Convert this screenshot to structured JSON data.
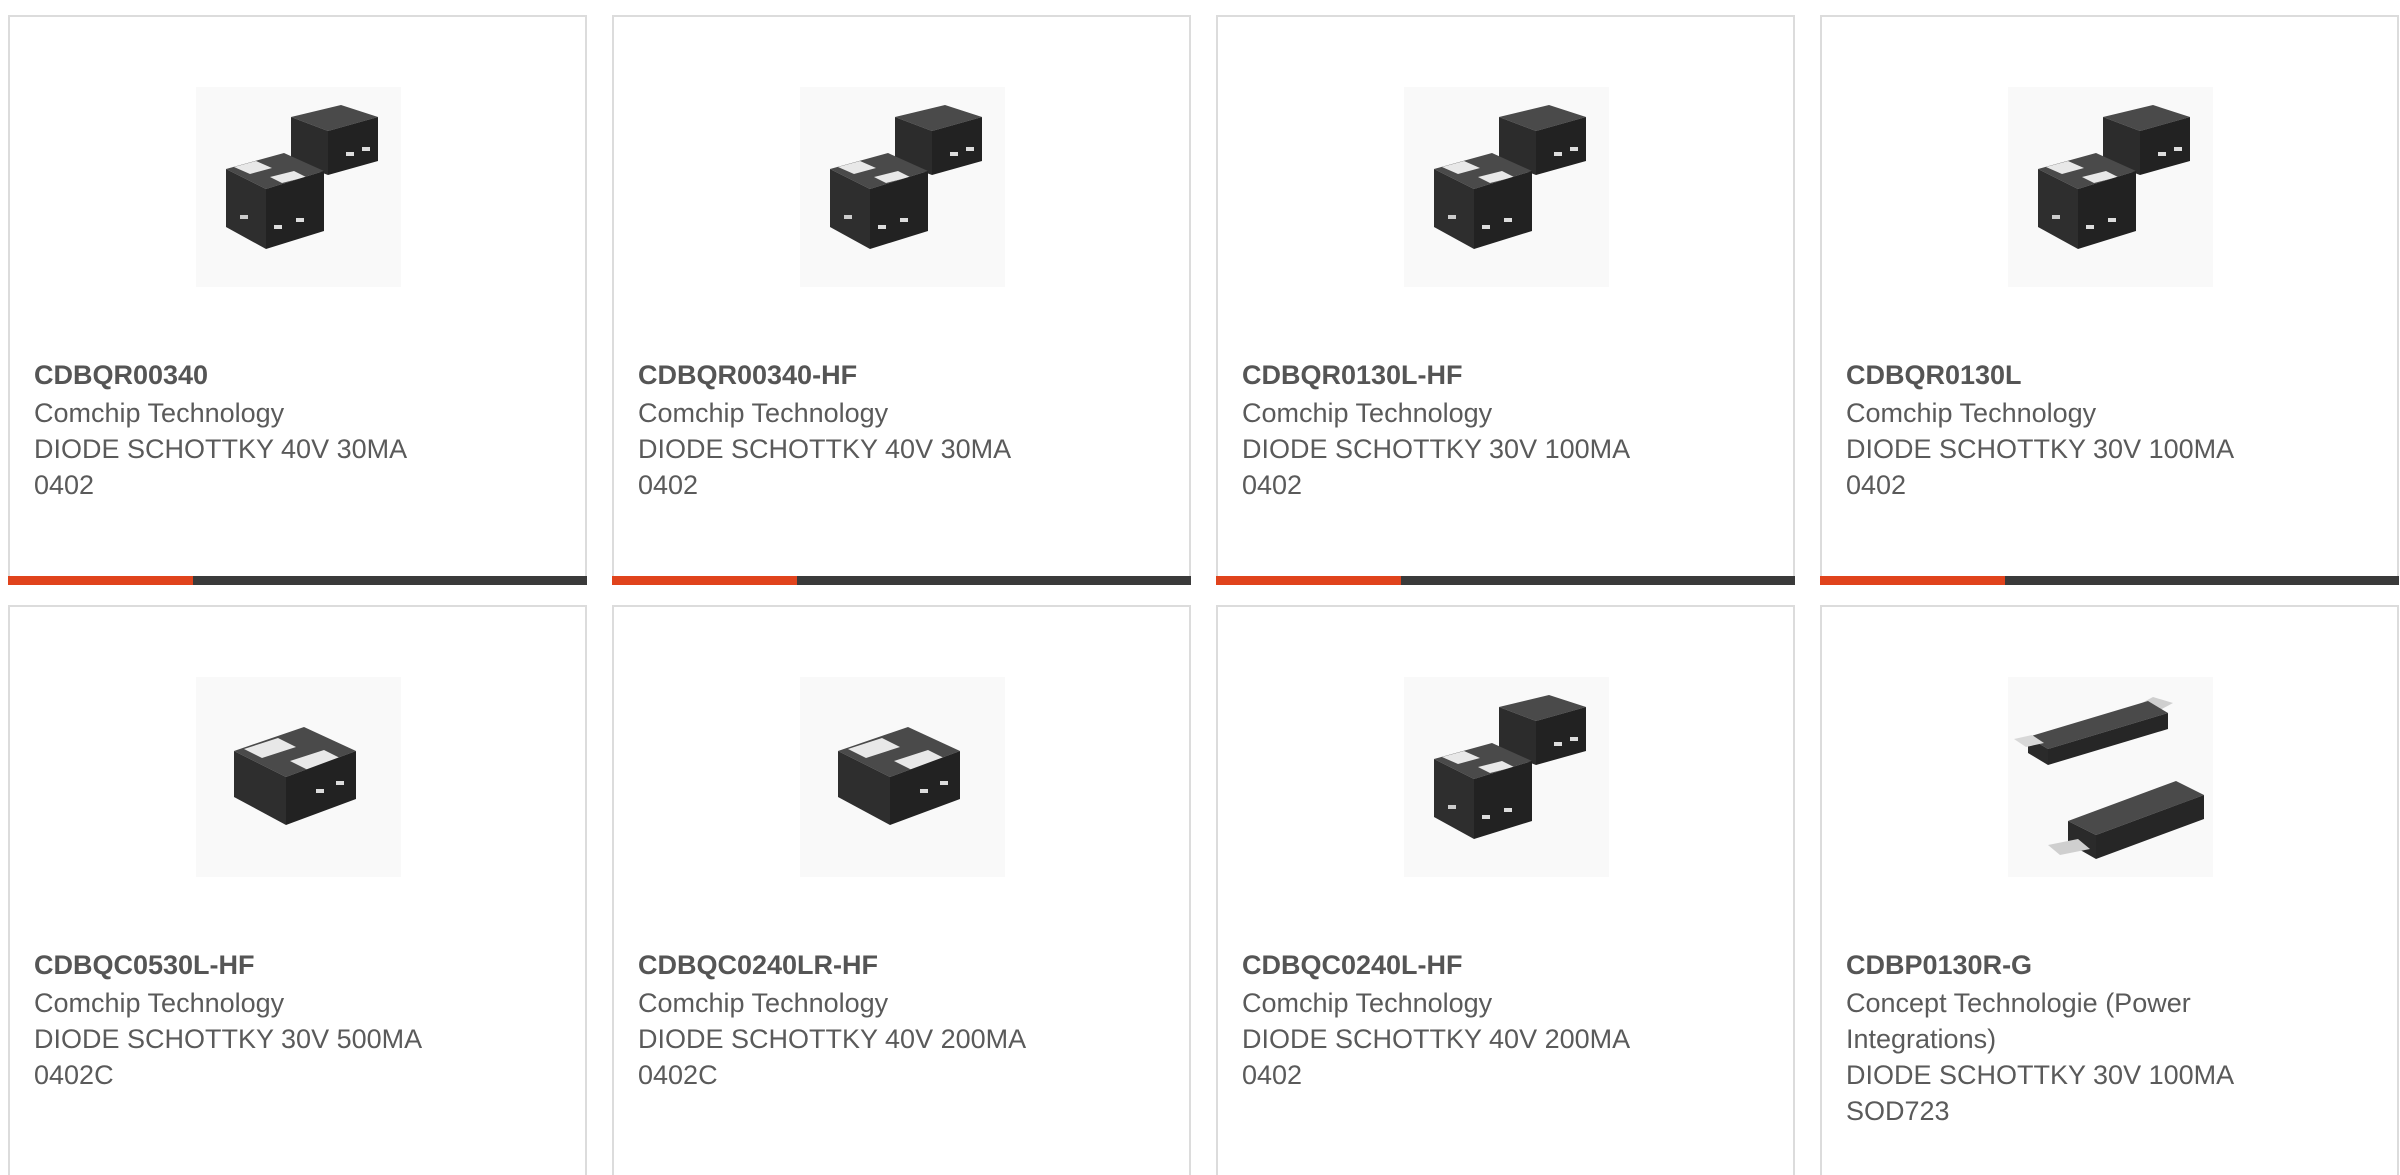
{
  "colors": {
    "accent": "#e0431c",
    "bar_dark": "#3a3a3a",
    "text": "#5a5a5a",
    "border": "#dcdcdc"
  },
  "products": [
    {
      "part": "CDBQR00340",
      "manufacturer": "Comchip Technology",
      "description": "DIODE SCHOTTKY 40V 30MA",
      "package": "0402",
      "image_icon": "dual-chip-package-icon",
      "progress": 0.32
    },
    {
      "part": "CDBQR00340-HF",
      "manufacturer": "Comchip Technology",
      "description": "DIODE SCHOTTKY 40V 30MA",
      "package": "0402",
      "image_icon": "dual-chip-package-icon",
      "progress": 0.32
    },
    {
      "part": "CDBQR0130L-HF",
      "manufacturer": "Comchip Technology",
      "description": "DIODE SCHOTTKY 30V 100MA",
      "package": "0402",
      "image_icon": "dual-chip-package-icon",
      "progress": 0.32
    },
    {
      "part": "CDBQR0130L",
      "manufacturer": "Comchip Technology",
      "description": "DIODE SCHOTTKY 30V 100MA",
      "package": "0402",
      "image_icon": "dual-chip-package-icon",
      "progress": 0.32
    },
    {
      "part": "CDBQC0530L-HF",
      "manufacturer": "Comchip Technology",
      "description": "DIODE SCHOTTKY 30V 500MA",
      "package": "0402C",
      "image_icon": "single-chip-package-icon"
    },
    {
      "part": "CDBQC0240LR-HF",
      "manufacturer": "Comchip Technology",
      "description": "DIODE SCHOTTKY 40V 200MA",
      "package": "0402C",
      "image_icon": "single-chip-package-icon"
    },
    {
      "part": "CDBQC0240L-HF",
      "manufacturer": "Comchip Technology",
      "description": "DIODE SCHOTTKY 40V 200MA",
      "package": "0402",
      "image_icon": "dual-chip-package-icon"
    },
    {
      "part": "CDBP0130R-G",
      "manufacturer": "Concept Technologie (Power Integrations)",
      "description": "DIODE SCHOTTKY 30V 100MA",
      "package": "SOD723",
      "image_icon": "sod723-package-icon"
    }
  ]
}
